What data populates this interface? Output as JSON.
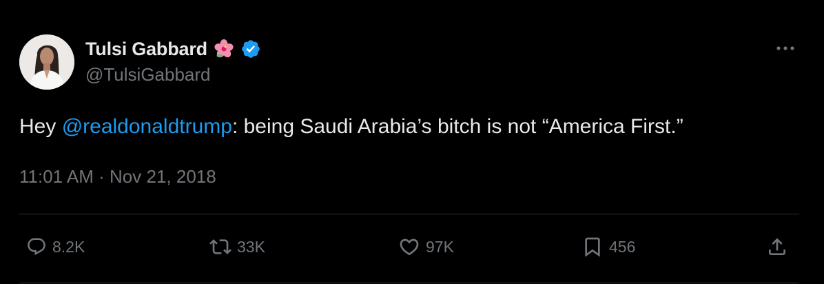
{
  "tweet": {
    "author": {
      "display_name": "Tulsi Gabbard",
      "emoji": "🌺",
      "handle": "@TulsiGabbard",
      "verified": true
    },
    "text": {
      "prefix": "Hey ",
      "mention": "@realdonaldtrump",
      "suffix": ": being Saudi Arabia’s bitch is not “America First.”"
    },
    "timestamp": "11:01 AM · Nov 21, 2018",
    "stats": {
      "replies": "8.2K",
      "reposts": "33K",
      "likes": "97K",
      "bookmarks": "456"
    }
  },
  "icons": {
    "more": "more-horizontal-icon",
    "reply": "reply-icon",
    "repost": "repost-icon",
    "like": "heart-icon",
    "bookmark": "bookmark-icon",
    "share": "share-icon",
    "verified": "verified-badge-icon"
  },
  "colors": {
    "background": "#000000",
    "text_primary": "#e7e9ea",
    "text_secondary": "#71767b",
    "link": "#1d9bf0",
    "verified": "#1d9bf0",
    "divider": "#2f3336"
  }
}
